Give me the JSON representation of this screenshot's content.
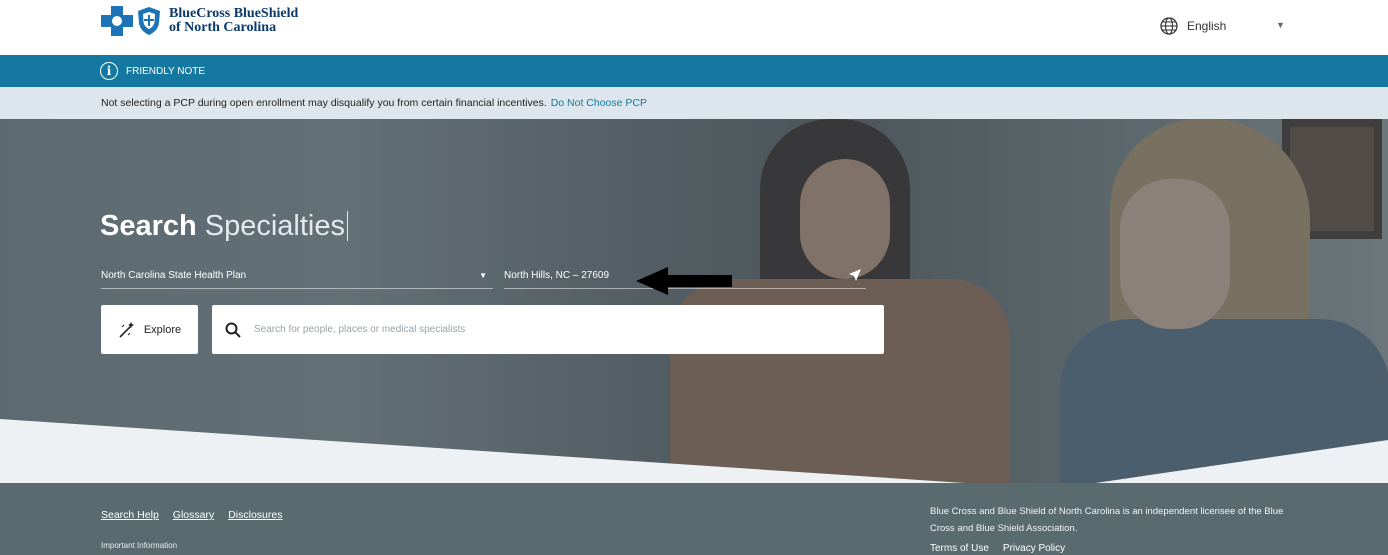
{
  "header": {
    "logo_line1": "BlueCross BlueShield",
    "logo_line2": "of North Carolina",
    "language": "English"
  },
  "friendly_note": {
    "label": "FRIENDLY NOTE",
    "message": "Not selecting a PCP during open enrollment may disqualify you from certain financial incentives.",
    "link": "Do Not Choose PCP"
  },
  "hero": {
    "title_bold": "Search",
    "title_sub": "Specialties",
    "plan": "North Carolina State Health Plan",
    "location": "North Hills, NC – 27609",
    "explore_label": "Explore",
    "search_placeholder": "Search for people, places or medical specialists"
  },
  "footer": {
    "links": [
      "Search Help",
      "Glossary",
      "Disclosures"
    ],
    "important": "Important Information",
    "license_text": "Blue Cross and Blue Shield of North Carolina is an independent licensee of the Blue Cross and Blue Shield Association.",
    "terms": "Terms of Use",
    "privacy": "Privacy Policy"
  },
  "colors": {
    "brand_blue": "#1c74b7",
    "note_bar": "#1478a0",
    "note_msg_bg": "#dde6ec",
    "footer_bg": "#5a6b70"
  },
  "icons": [
    "blue-cross-logo-icon",
    "blue-shield-logo-icon",
    "globe-icon",
    "chevron-down-icon",
    "info-icon",
    "location-arrow-icon",
    "explore-wand-icon",
    "search-icon",
    "annotation-arrow-icon"
  ]
}
